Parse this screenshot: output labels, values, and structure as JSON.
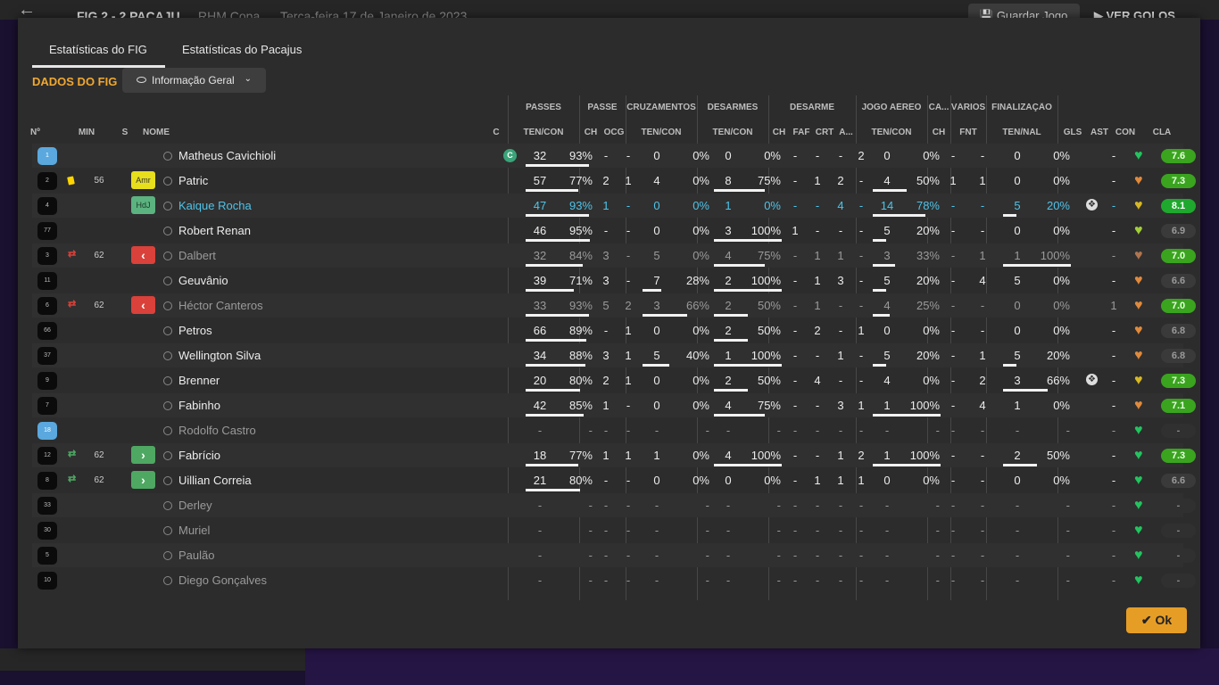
{
  "topbar": {
    "match": "FIG 2 - 2 PACAJU",
    "competition": "RHM Copa",
    "date": "Terça-feira 17 de Janeiro de 2023",
    "save_label": "Guardar Jogo",
    "goals_label": "VER GOLOS"
  },
  "tabs": [
    "Estatísticas do FIG",
    "Estatísticas do Pacajus"
  ],
  "active_tab": 0,
  "section_title": "DADOS DO FIG",
  "view_dropdown": "Informação Geral",
  "group_headers": [
    "PASSES",
    "PASSE",
    "CRUZAMENTOS",
    "DESARMES",
    "DESARME",
    "JOGO AÉREO",
    "CA...",
    "VÁRIOS",
    "FINALIZAÇÃO"
  ],
  "column_headers": [
    "Nº",
    "MIN",
    "S",
    "NOME",
    "C",
    "TEN/CON",
    "CH",
    "OCG",
    "TEN/CON",
    "TEN/CON",
    "CH",
    "FAF",
    "CRT",
    "A...",
    "TEN/CON",
    "CH",
    "FNT",
    "TEN/NAL",
    "GLS",
    "AST",
    "CON",
    "CLA"
  ],
  "ok_label": "Ok",
  "colors": {
    "accent": "#f0a830",
    "rating_green": "#3aa41f",
    "sub_out": "#d9413a",
    "sub_in": "#4ea862",
    "link_blue": "#4fc3e8"
  },
  "players": [
    {
      "num": "1",
      "gk": true,
      "card": "",
      "sub": "",
      "min": "",
      "pos": "",
      "name": "Matheus Cavichioli",
      "cap": "C",
      "dim": false,
      "hl": false,
      "ps_t": "32",
      "ps_p": "93%",
      "pa_ch": "-",
      "pa_ocg": "-",
      "cr_t": "0",
      "cr_p": "0%",
      "de_t": "0",
      "de_p": "0%",
      "d_ch": "-",
      "d_faf": "-",
      "d_crt": "-",
      "d_a": "2",
      "ae_t": "0",
      "ae_p": "0%",
      "ca_ch": "-",
      "v_fnt": "-",
      "fi_t": "0",
      "fi_p": "0%",
      "gls": "",
      "ast": "-",
      "con": "green",
      "cla": "7.6",
      "cla_s": "g"
    },
    {
      "num": "2",
      "gk": false,
      "card": "yellow",
      "sub": "",
      "min": "56",
      "pos": "Amr",
      "name": "Patric",
      "cap": "",
      "dim": false,
      "hl": false,
      "ps_t": "57",
      "ps_p": "77%",
      "pa_ch": "2",
      "pa_ocg": "1",
      "cr_t": "4",
      "cr_p": "0%",
      "de_t": "8",
      "de_p": "75%",
      "d_ch": "-",
      "d_faf": "1",
      "d_crt": "2",
      "d_a": "-",
      "ae_t": "4",
      "ae_p": "50%",
      "ca_ch": "1",
      "v_fnt": "1",
      "fi_t": "0",
      "fi_p": "0%",
      "gls": "",
      "ast": "-",
      "con": "orange",
      "cla": "7.3",
      "cla_s": "g"
    },
    {
      "num": "4",
      "gk": false,
      "card": "",
      "sub": "",
      "min": "",
      "pos": "HdJ",
      "name": "Kaique Rocha",
      "cap": "",
      "dim": false,
      "hl": true,
      "ps_t": "47",
      "ps_p": "93%",
      "pa_ch": "1",
      "pa_ocg": "-",
      "cr_t": "0",
      "cr_p": "0%",
      "de_t": "1",
      "de_p": "0%",
      "d_ch": "-",
      "d_faf": "-",
      "d_crt": "4",
      "d_a": "-",
      "ae_t": "14",
      "ae_p": "78%",
      "ca_ch": "-",
      "v_fnt": "-",
      "fi_t": "5",
      "fi_p": "20%",
      "gls": "ball",
      "ast": "-",
      "con": "yellow",
      "cla": "8.1",
      "cla_s": "bg"
    },
    {
      "num": "77",
      "gk": false,
      "card": "",
      "sub": "",
      "min": "",
      "pos": "",
      "name": "Robert Renan",
      "cap": "",
      "dim": false,
      "hl": false,
      "ps_t": "46",
      "ps_p": "95%",
      "pa_ch": "-",
      "pa_ocg": "-",
      "cr_t": "0",
      "cr_p": "0%",
      "de_t": "3",
      "de_p": "100%",
      "d_ch": "1",
      "d_faf": "-",
      "d_crt": "-",
      "d_a": "-",
      "ae_t": "5",
      "ae_p": "20%",
      "ca_ch": "-",
      "v_fnt": "-",
      "fi_t": "0",
      "fi_p": "0%",
      "gls": "",
      "ast": "-",
      "con": "lime",
      "cla": "6.9",
      "cla_s": "n"
    },
    {
      "num": "3",
      "gk": false,
      "card": "",
      "sub": "out",
      "min": "62",
      "pos": "out",
      "name": "Dalbert",
      "cap": "",
      "dim": true,
      "hl": false,
      "ps_t": "32",
      "ps_p": "84%",
      "pa_ch": "3",
      "pa_ocg": "-",
      "cr_t": "5",
      "cr_p": "0%",
      "de_t": "4",
      "de_p": "75%",
      "d_ch": "-",
      "d_faf": "1",
      "d_crt": "1",
      "d_a": "-",
      "ae_t": "3",
      "ae_p": "33%",
      "ca_ch": "-",
      "v_fnt": "1",
      "fi_t": "1",
      "fi_p": "100%",
      "gls": "",
      "ast": "-",
      "con": "brown",
      "cla": "7.0",
      "cla_s": "g"
    },
    {
      "num": "11",
      "gk": false,
      "card": "",
      "sub": "",
      "min": "",
      "pos": "",
      "name": "Geuvânio",
      "cap": "",
      "dim": false,
      "hl": false,
      "ps_t": "39",
      "ps_p": "71%",
      "pa_ch": "3",
      "pa_ocg": "-",
      "cr_t": "7",
      "cr_p": "28%",
      "de_t": "2",
      "de_p": "100%",
      "d_ch": "-",
      "d_faf": "1",
      "d_crt": "3",
      "d_a": "-",
      "ae_t": "5",
      "ae_p": "20%",
      "ca_ch": "-",
      "v_fnt": "4",
      "fi_t": "5",
      "fi_p": "0%",
      "gls": "",
      "ast": "-",
      "con": "orange",
      "cla": "6.6",
      "cla_s": "n"
    },
    {
      "num": "6",
      "gk": false,
      "card": "",
      "sub": "out",
      "min": "62",
      "pos": "out",
      "name": "Héctor Canteros",
      "cap": "",
      "dim": true,
      "hl": false,
      "ps_t": "33",
      "ps_p": "93%",
      "pa_ch": "5",
      "pa_ocg": "2",
      "cr_t": "3",
      "cr_p": "66%",
      "de_t": "2",
      "de_p": "50%",
      "d_ch": "-",
      "d_faf": "1",
      "d_crt": "-",
      "d_a": "-",
      "ae_t": "4",
      "ae_p": "25%",
      "ca_ch": "-",
      "v_fnt": "-",
      "fi_t": "0",
      "fi_p": "0%",
      "gls": "",
      "ast": "1",
      "con": "orange",
      "cla": "7.0",
      "cla_s": "g"
    },
    {
      "num": "66",
      "gk": false,
      "card": "",
      "sub": "",
      "min": "",
      "pos": "",
      "name": "Petros",
      "cap": "",
      "dim": false,
      "hl": false,
      "ps_t": "66",
      "ps_p": "89%",
      "pa_ch": "-",
      "pa_ocg": "1",
      "cr_t": "0",
      "cr_p": "0%",
      "de_t": "2",
      "de_p": "50%",
      "d_ch": "-",
      "d_faf": "2",
      "d_crt": "-",
      "d_a": "1",
      "ae_t": "0",
      "ae_p": "0%",
      "ca_ch": "-",
      "v_fnt": "-",
      "fi_t": "0",
      "fi_p": "0%",
      "gls": "",
      "ast": "-",
      "con": "orange",
      "cla": "6.8",
      "cla_s": "n"
    },
    {
      "num": "37",
      "gk": false,
      "card": "",
      "sub": "",
      "min": "",
      "pos": "",
      "name": "Wellington Silva",
      "cap": "",
      "dim": false,
      "hl": false,
      "ps_t": "34",
      "ps_p": "88%",
      "pa_ch": "3",
      "pa_ocg": "1",
      "cr_t": "5",
      "cr_p": "40%",
      "de_t": "1",
      "de_p": "100%",
      "d_ch": "-",
      "d_faf": "-",
      "d_crt": "1",
      "d_a": "-",
      "ae_t": "5",
      "ae_p": "20%",
      "ca_ch": "-",
      "v_fnt": "1",
      "fi_t": "5",
      "fi_p": "20%",
      "gls": "",
      "ast": "-",
      "con": "orange",
      "cla": "6.8",
      "cla_s": "n"
    },
    {
      "num": "9",
      "gk": false,
      "card": "",
      "sub": "",
      "min": "",
      "pos": "",
      "name": "Brenner",
      "cap": "",
      "dim": false,
      "hl": false,
      "ps_t": "20",
      "ps_p": "80%",
      "pa_ch": "2",
      "pa_ocg": "1",
      "cr_t": "0",
      "cr_p": "0%",
      "de_t": "2",
      "de_p": "50%",
      "d_ch": "-",
      "d_faf": "4",
      "d_crt": "-",
      "d_a": "-",
      "ae_t": "4",
      "ae_p": "0%",
      "ca_ch": "-",
      "v_fnt": "2",
      "fi_t": "3",
      "fi_p": "66%",
      "gls": "ball",
      "ast": "-",
      "con": "yellow",
      "cla": "7.3",
      "cla_s": "g"
    },
    {
      "num": "7",
      "gk": false,
      "card": "",
      "sub": "",
      "min": "",
      "pos": "",
      "name": "Fabinho",
      "cap": "",
      "dim": false,
      "hl": false,
      "ps_t": "42",
      "ps_p": "85%",
      "pa_ch": "1",
      "pa_ocg": "-",
      "cr_t": "0",
      "cr_p": "0%",
      "de_t": "4",
      "de_p": "75%",
      "d_ch": "-",
      "d_faf": "-",
      "d_crt": "3",
      "d_a": "1",
      "ae_t": "1",
      "ae_p": "100%",
      "ca_ch": "-",
      "v_fnt": "4",
      "fi_t": "1",
      "fi_p": "0%",
      "gls": "",
      "ast": "-",
      "con": "orange",
      "cla": "7.1",
      "cla_s": "g"
    },
    {
      "num": "18",
      "gk": true,
      "card": "",
      "sub": "",
      "min": "",
      "pos": "",
      "name": "Rodolfo Castro",
      "cap": "",
      "dim": true,
      "hl": false,
      "ps_t": "-",
      "ps_p": "-",
      "pa_ch": "-",
      "pa_ocg": "-",
      "cr_t": "-",
      "cr_p": "-",
      "de_t": "-",
      "de_p": "-",
      "d_ch": "-",
      "d_faf": "-",
      "d_crt": "-",
      "d_a": "-",
      "ae_t": "-",
      "ae_p": "-",
      "ca_ch": "-",
      "v_fnt": "-",
      "fi_t": "-",
      "fi_p": "-",
      "gls": "",
      "ast": "-",
      "con": "green",
      "cla": "-",
      "cla_s": "none"
    },
    {
      "num": "12",
      "gk": false,
      "card": "",
      "sub": "in",
      "min": "62",
      "pos": "in",
      "name": "Fabrício",
      "cap": "",
      "dim": false,
      "hl": false,
      "ps_t": "18",
      "ps_p": "77%",
      "pa_ch": "1",
      "pa_ocg": "1",
      "cr_t": "1",
      "cr_p": "0%",
      "de_t": "4",
      "de_p": "100%",
      "d_ch": "-",
      "d_faf": "-",
      "d_crt": "1",
      "d_a": "2",
      "ae_t": "1",
      "ae_p": "100%",
      "ca_ch": "-",
      "v_fnt": "-",
      "fi_t": "2",
      "fi_p": "50%",
      "gls": "",
      "ast": "-",
      "con": "green",
      "cla": "7.3",
      "cla_s": "g"
    },
    {
      "num": "8",
      "gk": false,
      "card": "",
      "sub": "in",
      "min": "62",
      "pos": "in",
      "name": "Uillian Correia",
      "cap": "",
      "dim": false,
      "hl": false,
      "ps_t": "21",
      "ps_p": "80%",
      "pa_ch": "-",
      "pa_ocg": "-",
      "cr_t": "0",
      "cr_p": "0%",
      "de_t": "0",
      "de_p": "0%",
      "d_ch": "-",
      "d_faf": "1",
      "d_crt": "1",
      "d_a": "1",
      "ae_t": "0",
      "ae_p": "0%",
      "ca_ch": "-",
      "v_fnt": "-",
      "fi_t": "0",
      "fi_p": "0%",
      "gls": "",
      "ast": "-",
      "con": "green",
      "cla": "6.6",
      "cla_s": "n"
    },
    {
      "num": "33",
      "gk": false,
      "card": "",
      "sub": "",
      "min": "",
      "pos": "",
      "name": "Derley",
      "cap": "",
      "dim": true,
      "hl": false,
      "ps_t": "-",
      "ps_p": "-",
      "pa_ch": "-",
      "pa_ocg": "-",
      "cr_t": "-",
      "cr_p": "-",
      "de_t": "-",
      "de_p": "-",
      "d_ch": "-",
      "d_faf": "-",
      "d_crt": "-",
      "d_a": "-",
      "ae_t": "-",
      "ae_p": "-",
      "ca_ch": "-",
      "v_fnt": "-",
      "fi_t": "-",
      "fi_p": "-",
      "gls": "",
      "ast": "-",
      "con": "green",
      "cla": "-",
      "cla_s": "none"
    },
    {
      "num": "30",
      "gk": false,
      "card": "",
      "sub": "",
      "min": "",
      "pos": "",
      "name": "Muriel",
      "cap": "",
      "dim": true,
      "hl": false,
      "ps_t": "-",
      "ps_p": "-",
      "pa_ch": "-",
      "pa_ocg": "-",
      "cr_t": "-",
      "cr_p": "-",
      "de_t": "-",
      "de_p": "-",
      "d_ch": "-",
      "d_faf": "-",
      "d_crt": "-",
      "d_a": "-",
      "ae_t": "-",
      "ae_p": "-",
      "ca_ch": "-",
      "v_fnt": "-",
      "fi_t": "-",
      "fi_p": "-",
      "gls": "",
      "ast": "-",
      "con": "green",
      "cla": "-",
      "cla_s": "none"
    },
    {
      "num": "5",
      "gk": false,
      "card": "",
      "sub": "",
      "min": "",
      "pos": "",
      "name": "Paulão",
      "cap": "",
      "dim": true,
      "hl": false,
      "ps_t": "-",
      "ps_p": "-",
      "pa_ch": "-",
      "pa_ocg": "-",
      "cr_t": "-",
      "cr_p": "-",
      "de_t": "-",
      "de_p": "-",
      "d_ch": "-",
      "d_faf": "-",
      "d_crt": "-",
      "d_a": "-",
      "ae_t": "-",
      "ae_p": "-",
      "ca_ch": "-",
      "v_fnt": "-",
      "fi_t": "-",
      "fi_p": "-",
      "gls": "",
      "ast": "-",
      "con": "green",
      "cla": "-",
      "cla_s": "none"
    },
    {
      "num": "10",
      "gk": false,
      "card": "",
      "sub": "",
      "min": "",
      "pos": "",
      "name": "Diego Gonçalves",
      "cap": "",
      "dim": true,
      "hl": false,
      "ps_t": "-",
      "ps_p": "-",
      "pa_ch": "-",
      "pa_ocg": "-",
      "cr_t": "-",
      "cr_p": "-",
      "de_t": "-",
      "de_p": "-",
      "d_ch": "-",
      "d_faf": "-",
      "d_crt": "-",
      "d_a": "-",
      "ae_t": "-",
      "ae_p": "-",
      "ca_ch": "-",
      "v_fnt": "-",
      "fi_t": "-",
      "fi_p": "-",
      "gls": "",
      "ast": "-",
      "con": "green",
      "cla": "-",
      "cla_s": "none"
    }
  ]
}
